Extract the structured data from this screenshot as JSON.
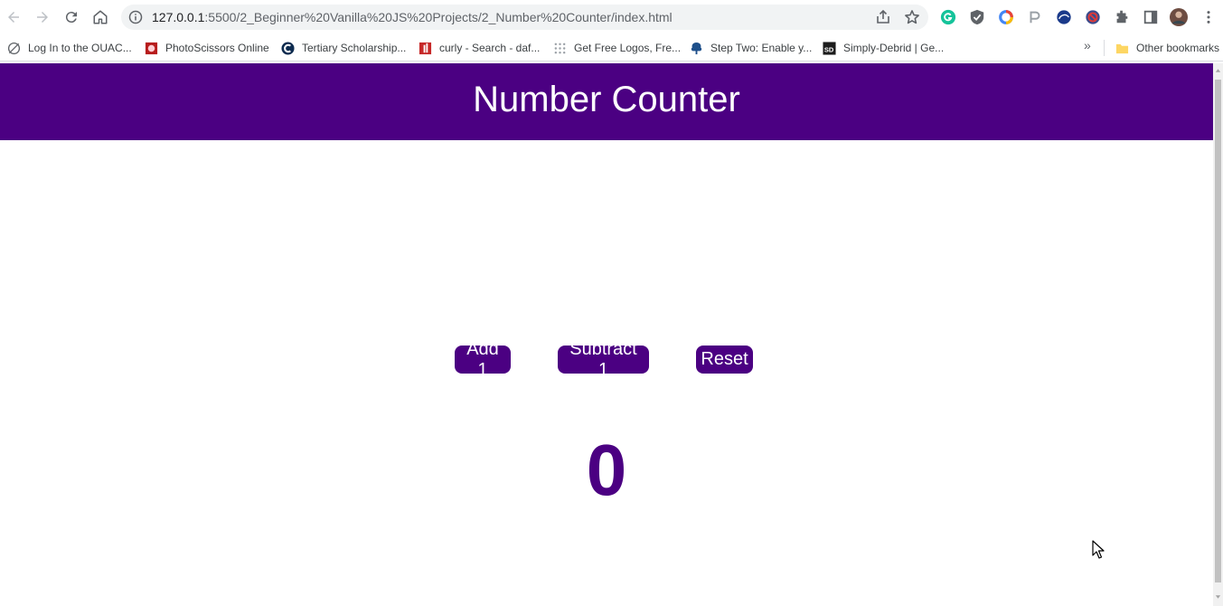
{
  "browser": {
    "url_host": "127.0.0.1",
    "url_path": ":5500/2_Beginner%20Vanilla%20JS%20Projects/2_Number%20Counter/index.html"
  },
  "bookmarks": [
    {
      "label": "Log In to the OUAC...",
      "icon": "globe-slash-icon"
    },
    {
      "label": "PhotoScissors Online",
      "icon": "photoscissors-icon"
    },
    {
      "label": "Tertiary Scholarship...",
      "icon": "c-logo-icon"
    },
    {
      "label": "curly - Search - daf...",
      "icon": "red-book-icon"
    },
    {
      "label": "Get Free Logos, Fre...",
      "icon": "grid-dots-icon"
    },
    {
      "label": "Step Two: Enable y...",
      "icon": "tree-icon"
    },
    {
      "label": "Simply-Debrid | Ge...",
      "icon": "sd-logo-icon"
    }
  ],
  "other_bookmarks": "Other bookmarks",
  "page": {
    "title": "Number Counter",
    "buttons": {
      "add": "Add 1",
      "subtract": "Subtract 1",
      "reset": "Reset"
    },
    "count": "0"
  },
  "colors": {
    "accent": "#4b0082",
    "header_text": "#ffffff"
  }
}
